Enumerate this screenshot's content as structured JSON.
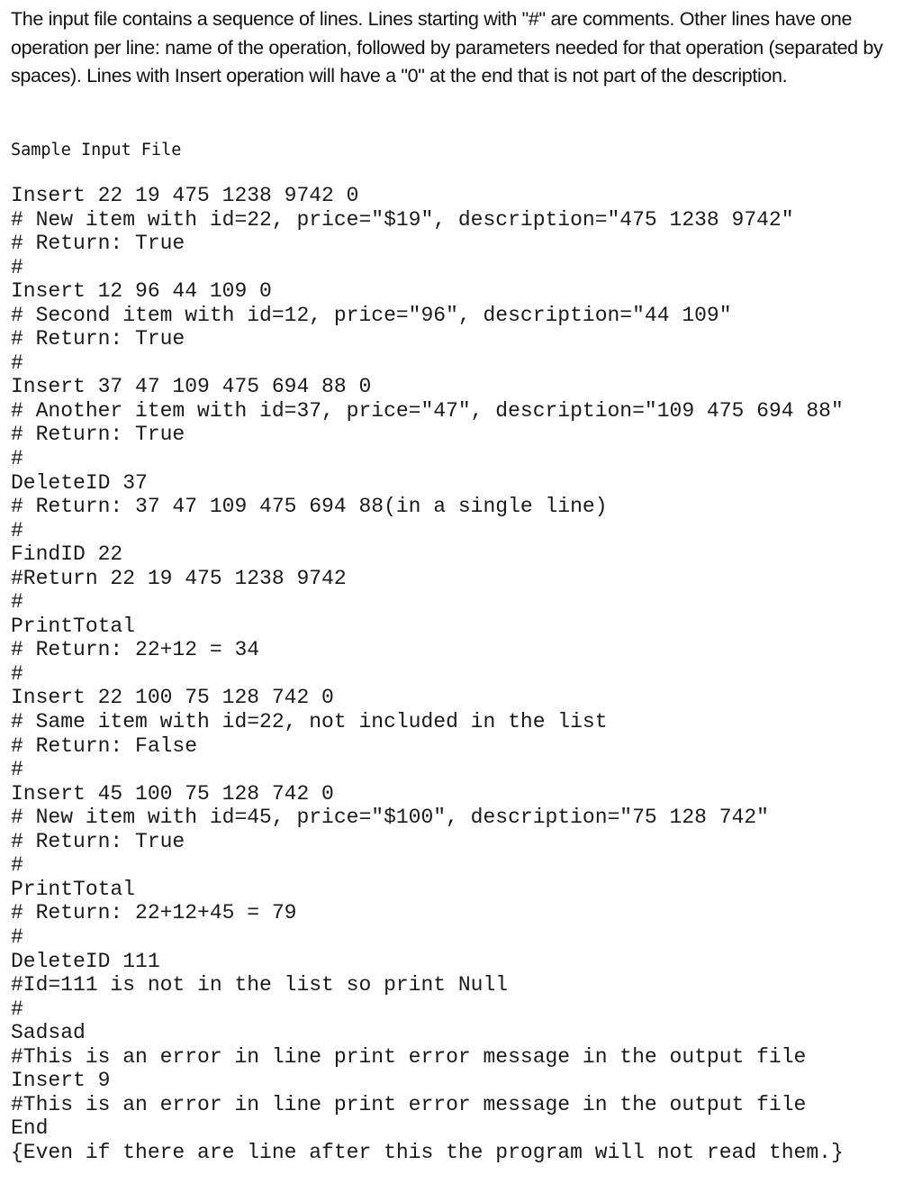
{
  "intro": {
    "paragraph": "The input file contains a sequence of lines. Lines starting with \"#\" are comments.  Other lines have one operation per line: name of the operation, followed by parameters needed for that operation (separated by spaces).  Lines with Insert operation will have a \"0\" at the end that is not part of the description."
  },
  "sample": {
    "title": "Sample Input File",
    "lines": [
      "Insert 22 19 475 1238 9742 0",
      "# New item with id=22, price=\"$19\", description=\"475 1238 9742\"",
      "# Return: True",
      "#",
      "Insert 12 96 44 109 0",
      "# Second item with id=12, price=\"96\", description=\"44 109\"",
      "# Return: True",
      "#",
      "Insert 37 47 109 475 694 88 0",
      "# Another item with id=37, price=\"47\", description=\"109 475 694 88\"",
      "# Return: True",
      "#",
      "DeleteID 37",
      "# Return: 37 47 109 475 694 88(in a single line)",
      "#",
      "FindID 22",
      "#Return 22 19 475 1238 9742",
      "#",
      "PrintTotal",
      "# Return: 22+12 = 34",
      "#",
      "Insert 22 100 75 128 742 0",
      "# Same item with id=22, not included in the list",
      "# Return: False",
      "#",
      "Insert 45 100 75 128 742 0",
      "# New item with id=45, price=\"$100\", description=\"75 128 742\"",
      "# Return: True",
      "#",
      "PrintTotal",
      "# Return: 22+12+45 = 79",
      "#",
      "DeleteID 111",
      "#Id=111 is not in the list so print Null",
      "#",
      "Sadsad",
      "#This is an error in line print error message in the output file",
      "Insert 9",
      "#This is an error in line print error message in the output file",
      "End",
      "{Even if there are line after this the program will not read them.}"
    ]
  }
}
